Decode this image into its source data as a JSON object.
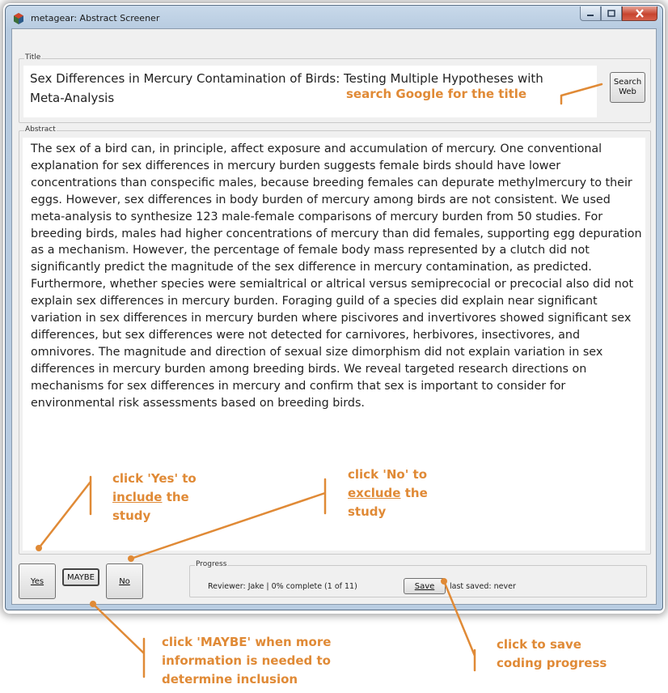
{
  "window": {
    "title": "metagear: Abstract Screener",
    "controls": {
      "minimize_icon": "minimize-icon",
      "maximize_icon": "maximize-icon",
      "close_icon": "close-icon"
    }
  },
  "title_group": {
    "legend": "Title",
    "value": "Sex Differences in Mercury Contamination of Birds: Testing Multiple Hypotheses with Meta-Analysis",
    "search_button_label": "Search Web"
  },
  "abstract_group": {
    "legend": "Abstract",
    "text": "The sex of a bird can, in principle, affect exposure and accumulation of mercury. One conventional explanation for sex differences in mercury burden suggests female birds should have lower concentrations than conspecific males, because breeding females can depurate methylmercury to their eggs. However, sex differences in body burden of mercury among birds are not consistent. We used meta-analysis to synthesize 123 male-female comparisons of mercury burden from 50 studies. For breeding birds, males had higher concentrations of mercury than did females, supporting egg depuration as a mechanism. However, the percentage of female body mass represented by a clutch did not significantly predict the magnitude of the sex difference in mercury contamination, as predicted. Furthermore, whether species were semialtrical or altrical versus semiprecocial or precocial also did not explain sex differences in mercury burden. Foraging guild of a species did explain near significant variation in sex differences in mercury burden where piscivores and invertivores showed significant sex differences, but sex differences were not detected for carnivores, herbivores, insectivores, and omnivores. The magnitude and direction of sexual size dimorphism did not explain variation in sex differences in mercury burden among breeding birds. We reveal targeted research directions on mechanisms for sex differences in mercury and confirm that sex is important to consider for environmental risk assessments based on breeding birds."
  },
  "decision_buttons": {
    "yes": "Yes",
    "maybe": "MAYBE",
    "no": "No"
  },
  "progress": {
    "legend": "Progress",
    "status": "Reviewer: Jake  |  0% complete (1 of 11)",
    "save_label": "Save",
    "last_saved": "last saved: never"
  },
  "annotations": {
    "search": "search Google for the title",
    "yes": {
      "pre": "click 'Yes' to",
      "key": "include",
      "post": "the",
      "last": "study"
    },
    "no": {
      "pre": "click 'No' to",
      "key": "exclude",
      "post": "the",
      "last": "study"
    },
    "maybe": [
      "click 'MAYBE' when more",
      "information is needed to",
      "determine inclusion"
    ],
    "save": [
      "click to save",
      "coding progress"
    ],
    "color": "#e08a36"
  }
}
